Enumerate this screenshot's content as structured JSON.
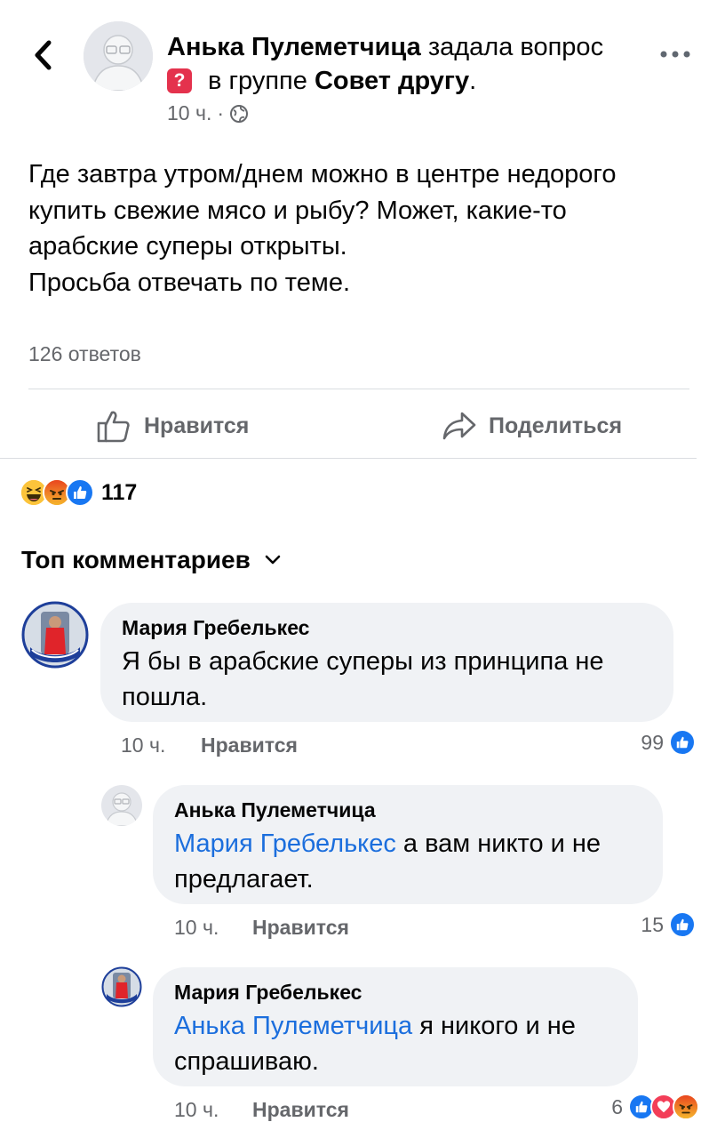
{
  "header": {
    "author": "Анька Пулеметчица",
    "action": "задала вопрос",
    "group_prefix": "в группе",
    "group_name": "Совет другу",
    "group_suffix": ".",
    "time": "10 ч.",
    "dot": "·",
    "privacy_icon": "globe-icon",
    "more_icon": "more-dots-icon",
    "back_icon": "chevron-left-icon",
    "badge_icon": "question-badge-icon",
    "badge_glyph": "?"
  },
  "post": {
    "text": "Где завтра утром/днем можно в центре недорого\nкупить свежие мясо  и рыбу? Может,  какие-то\nарабские суперы  открыты.\nПросьба отвечать по теме.",
    "answers_count": "126 ответов"
  },
  "actions": {
    "like_label": "Нравится",
    "share_label": "Поделиться"
  },
  "reactions": {
    "types": [
      "haha",
      "angry",
      "like"
    ],
    "count": "117"
  },
  "comments_header": {
    "label": "Топ комментариев"
  },
  "comments": [
    {
      "name": "Мария Гребелькес",
      "text": "Я бы в арабские суперы из принципа не пошла.",
      "time": "10 ч.",
      "like_label": "Нравится",
      "reaction_count": "99",
      "reactions": [
        "like"
      ]
    },
    {
      "name": "Анька Пулеметчица",
      "mention": "Мария Гребелькес",
      "text": "а вам никто и не предлагает.",
      "time": "10 ч.",
      "like_label": "Нравится",
      "reaction_count": "15",
      "reactions": [
        "like"
      ]
    },
    {
      "name": "Мария Гребелькес",
      "mention": "Анька Пулеметчица",
      "text": "я никого и не спрашиваю.",
      "time": "10 ч.",
      "like_label": "Нравится",
      "reaction_count": "6",
      "reactions": [
        "like",
        "love",
        "angry"
      ]
    }
  ],
  "colors": {
    "link": "#1b6edd",
    "muted": "#65676b",
    "bubble": "#f0f2f5",
    "like": "#1877f2",
    "love": "#f33e58",
    "angry": "#f0801f"
  }
}
